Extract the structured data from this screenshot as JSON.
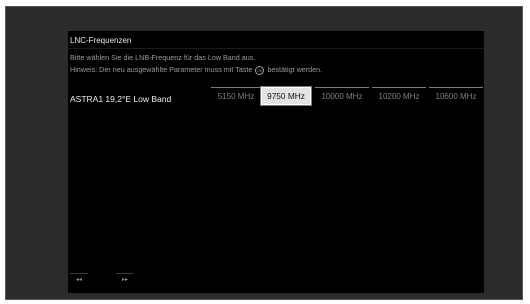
{
  "screen": {
    "title": "LNC-Frequenzen",
    "hint_line1": "Bitte wählen Sie die LNB-Frequenz für das Low Band aus.",
    "hint_line2_before": "Hinweis: Der neu ausgewählte Parameter muss mit Taste",
    "hint_ok_icon": "OK",
    "hint_line2_after": "bestätigt werden."
  },
  "setting": {
    "label": "ASTRA1 19,2°E Low Band",
    "options": [
      "5150 MHz",
      "9750 MHz",
      "10000 MHz",
      "10200 MHz",
      "10600 MHz"
    ],
    "selected": "9750 MHz"
  },
  "nav": {
    "rewind": "◂◂",
    "forward": "▸▸"
  },
  "icons": {
    "ok": "ok-button-icon",
    "rewind": "rewind-icon",
    "forward": "fast-forward-icon"
  },
  "colors": {
    "background": "#000000",
    "frame": "#2c2b29",
    "selected": "#e3e3e3"
  }
}
